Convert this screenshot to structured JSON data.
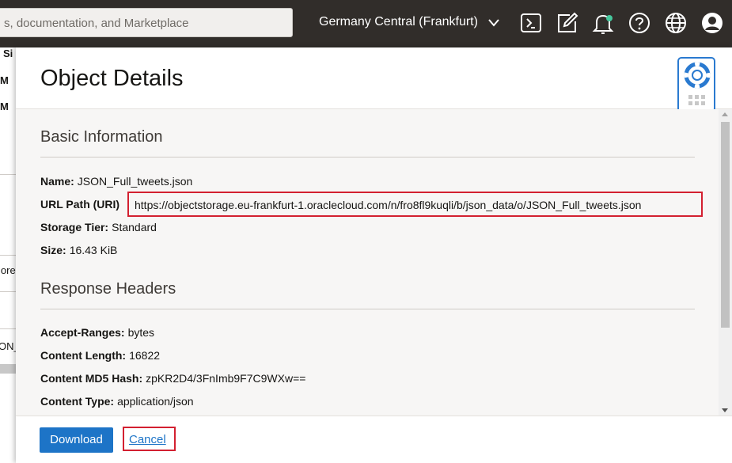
{
  "topbar": {
    "search_placeholder": "s, documentation, and Marketplace",
    "region": "Germany Central (Frankfurt)",
    "icons": [
      "cloud-shell-icon",
      "edit-icon",
      "bell-icon",
      "help-icon",
      "globe-icon",
      "user-icon"
    ]
  },
  "background": {
    "fragments": [
      "Si",
      "M",
      "M",
      "lore",
      "ON_"
    ]
  },
  "panel": {
    "title": "Object Details",
    "basic_info": {
      "heading": "Basic Information",
      "name_label": "Name:",
      "name_value": "JSON_Full_tweets.json",
      "url_label": "URL Path (URI)",
      "url_value": "https://objectstorage.eu-frankfurt-1.oraclecloud.com/n/fro8fl9kuqli/b/json_data/o/JSON_Full_tweets.json",
      "tier_label": "Storage Tier:",
      "tier_value": "Standard",
      "size_label": "Size:",
      "size_value": "16.43 KiB"
    },
    "response_headers": {
      "heading": "Response Headers",
      "accept_ranges_label": "Accept-Ranges:",
      "accept_ranges_value": "bytes",
      "content_length_label": "Content Length:",
      "content_length_value": "16822",
      "md5_label": "Content MD5 Hash:",
      "md5_value": "zpKR2D4/3FnImb9F7C9WXw==",
      "content_type_label": "Content Type:",
      "content_type_value": "application/json"
    },
    "footer": {
      "download_label": "Download",
      "cancel_label": "Cancel"
    }
  },
  "colors": {
    "topbar_bg": "#312d2a",
    "primary_button": "#1d74c7",
    "highlight_red": "#d32030",
    "help_widget_border": "#2a7ad0"
  }
}
